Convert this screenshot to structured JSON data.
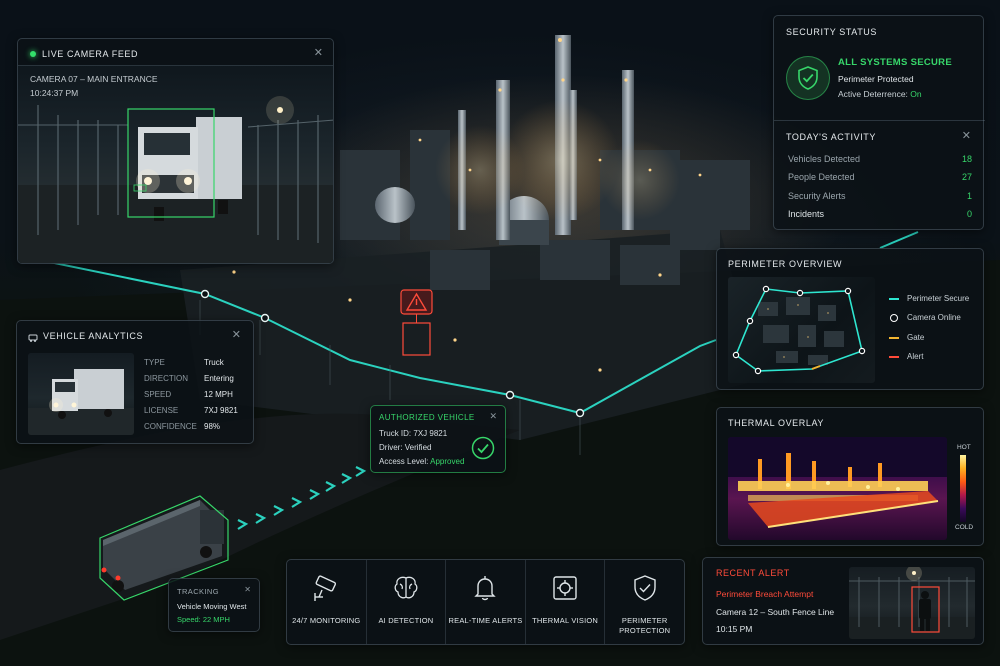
{
  "live_feed": {
    "title": "LIVE CAMERA FEED",
    "camera": "CAMERA 07 – MAIN ENTRANCE",
    "time": "10:24:37 PM"
  },
  "security_status": {
    "title": "SECURITY STATUS",
    "status": "ALL SYSTEMS SECURE",
    "perimeter": "Perimeter Protected",
    "deterrence_label": "Active Deterrence:",
    "deterrence_value": "On"
  },
  "activity": {
    "title": "TODAY'S ACTIVITY",
    "rows": [
      {
        "label": "Vehicles Detected",
        "value": "18",
        "color": "#37d66a"
      },
      {
        "label": "People Detected",
        "value": "27",
        "color": "#37d66a"
      },
      {
        "label": "Security Alerts",
        "value": "1",
        "color": "#37d66a"
      },
      {
        "label": "Incidents",
        "value": "0",
        "color": "#37d66a"
      }
    ]
  },
  "vehicle_analytics": {
    "title": "VEHICLE ANALYTICS",
    "rows": [
      {
        "key": "TYPE",
        "value": "Truck",
        "color": "#e2e7ea"
      },
      {
        "key": "DIRECTION",
        "value": "Entering",
        "color": "#e2e7ea"
      },
      {
        "key": "SPEED",
        "value": "12 MPH",
        "color": "#37d66a"
      },
      {
        "key": "LICENSE",
        "value": "7XJ 9821",
        "color": "#37d66a"
      },
      {
        "key": "CONFIDENCE",
        "value": "98%",
        "color": "#37d66a"
      }
    ]
  },
  "authorized": {
    "title": "AUTHORIZED VEHICLE",
    "truck_id": "Truck ID: 7XJ 9821",
    "driver": "Driver: Verified",
    "access_label": "Access Level:",
    "access_value": "Approved"
  },
  "perimeter": {
    "title": "PERIMETER OVERVIEW",
    "legend": [
      {
        "label": "Perimeter Secure",
        "color": "#2ee6d0",
        "kind": "line"
      },
      {
        "label": "Camera Online",
        "color": "#ffffff",
        "kind": "ring"
      },
      {
        "label": "Gate",
        "color": "#f2b531",
        "kind": "line"
      },
      {
        "label": "Alert",
        "color": "#ff4b3a",
        "kind": "line"
      }
    ]
  },
  "thermal": {
    "title": "THERMAL OVERLAY",
    "hot": "HOT",
    "cold": "COLD"
  },
  "tracking": {
    "title": "TRACKING",
    "line1": "Vehicle Moving West",
    "line2": "Speed: 22 MPH"
  },
  "features": [
    {
      "label": "24/7 MONITORING",
      "icon": "cctv-camera-icon"
    },
    {
      "label": "AI DETECTION",
      "icon": "brain-icon"
    },
    {
      "label": "REAL-TIME ALERTS",
      "icon": "bell-icon"
    },
    {
      "label": "THERMAL VISION",
      "icon": "thermal-target-icon"
    },
    {
      "label": "PERIMETER PROTECTION",
      "icon": "shield-check-icon"
    }
  ],
  "recent_alert": {
    "title": "RECENT ALERT",
    "event": "Perimeter Breach Attempt",
    "location": "Camera 12 – South Fence Line",
    "time": "10:15 PM"
  },
  "colors": {
    "accent_green": "#37d66a",
    "accent_cyan": "#2ee6d0",
    "alert_red": "#ff4b3a"
  }
}
